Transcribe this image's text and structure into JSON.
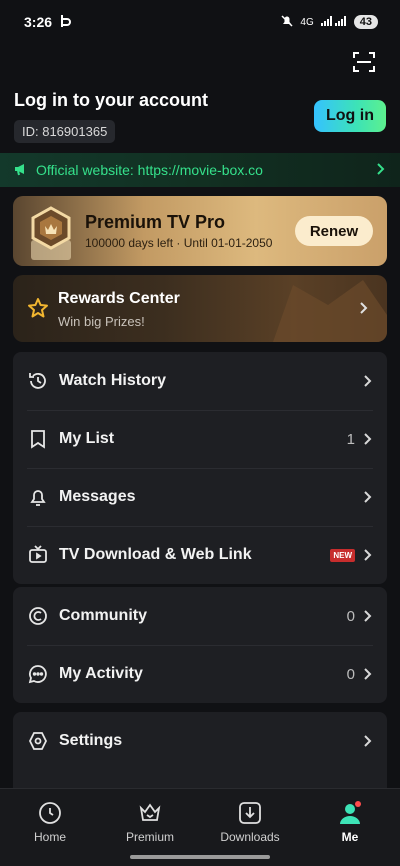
{
  "status_bar": {
    "time": "3:26",
    "network": "4G",
    "battery": "43"
  },
  "account": {
    "title": "Log in to your account",
    "id_label": "ID: 816901365",
    "login_label": "Log in"
  },
  "official": {
    "text": "Official website: https://movie-box.co"
  },
  "premium": {
    "title": "Premium TV Pro",
    "subtitle": "100000 days left · Until 01-01-2050",
    "renew_label": "Renew"
  },
  "rewards": {
    "title": "Rewards Center",
    "subtitle": "Win big Prizes!"
  },
  "menu_group_1": [
    {
      "label": "Watch History",
      "icon": "history-icon"
    },
    {
      "label": "My List",
      "icon": "bookmark-icon",
      "count": "1"
    },
    {
      "label": "Messages",
      "icon": "bell-icon"
    },
    {
      "label": "TV Download & Web Link",
      "icon": "tv-icon",
      "badge": "NEW"
    }
  ],
  "menu_group_2": [
    {
      "label": "Community",
      "icon": "community-icon",
      "count": "0"
    },
    {
      "label": "My Activity",
      "icon": "chat-bubble-icon",
      "count": "0"
    }
  ],
  "menu_group_3": [
    {
      "label": "Settings",
      "icon": "gear-icon"
    }
  ],
  "bottom_nav": [
    {
      "label": "Home",
      "icon": "home-icon"
    },
    {
      "label": "Premium",
      "icon": "crown-icon"
    },
    {
      "label": "Downloads",
      "icon": "download-icon"
    },
    {
      "label": "Me",
      "icon": "profile-icon",
      "active": true
    }
  ],
  "colors": {
    "background": "#101114",
    "card": "#1e1f23",
    "accent_green": "#35e08b",
    "new_badge": "#c72d2d"
  }
}
